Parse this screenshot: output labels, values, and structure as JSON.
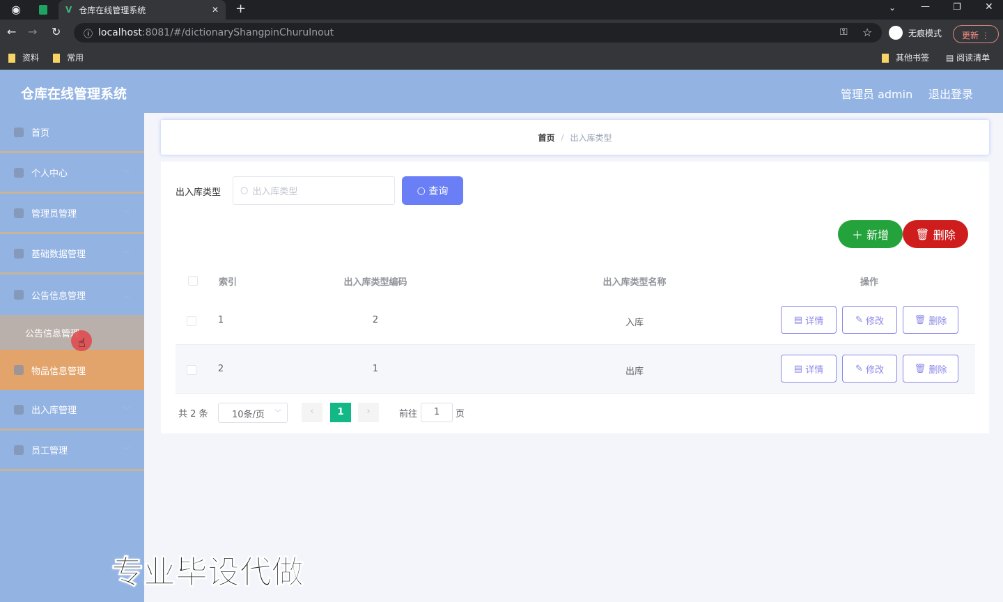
{
  "browser": {
    "tab_title": "仓库在线管理系统",
    "url_host": "localhost",
    "url_path": ":8081/#/dictionaryShangpinChuruInout",
    "incognito": "无痕模式",
    "update": "更新",
    "bookmarks": [
      "资料",
      "常用"
    ],
    "other_bookmarks": "其他书签",
    "reading_list": "阅读清单"
  },
  "header": {
    "title": "仓库在线管理系统",
    "user": "管理员 admin",
    "logout": "退出登录"
  },
  "sidebar": {
    "items": [
      "首页",
      "个人中心",
      "管理员管理",
      "基础数据管理",
      "公告信息管理"
    ],
    "sub_item": "公告信息管理",
    "items2": [
      "物品信息管理",
      "出入库管理",
      "员工管理"
    ]
  },
  "breadcrumb": {
    "home": "首页",
    "sep": "/",
    "current": "出入库类型"
  },
  "search": {
    "label": "出入库类型",
    "placeholder": "出入库类型",
    "button": "查询"
  },
  "actions": {
    "add": "新增",
    "delete": "删除"
  },
  "table": {
    "headers": [
      "索引",
      "出入库类型编码",
      "出入库类型名称",
      "操作"
    ],
    "rows": [
      {
        "index": "1",
        "code": "2",
        "name": "入库"
      },
      {
        "index": "2",
        "code": "1",
        "name": "出库"
      }
    ],
    "row_actions": {
      "detail": "详情",
      "edit": "修改",
      "delete": "删除"
    }
  },
  "pagination": {
    "total": "共 2 条",
    "page_size": "10条/页",
    "current_page": "1",
    "goto_label": "前往",
    "goto_value": "1",
    "page_suffix": "页"
  },
  "watermark": "专业毕设代做",
  "colors": {
    "header": "#93b3e3",
    "primary": "#6a7ef6",
    "success": "#24a33c",
    "danger": "#cf1c1c",
    "active_menu": "#e3a46c",
    "page_active": "#12b886"
  }
}
